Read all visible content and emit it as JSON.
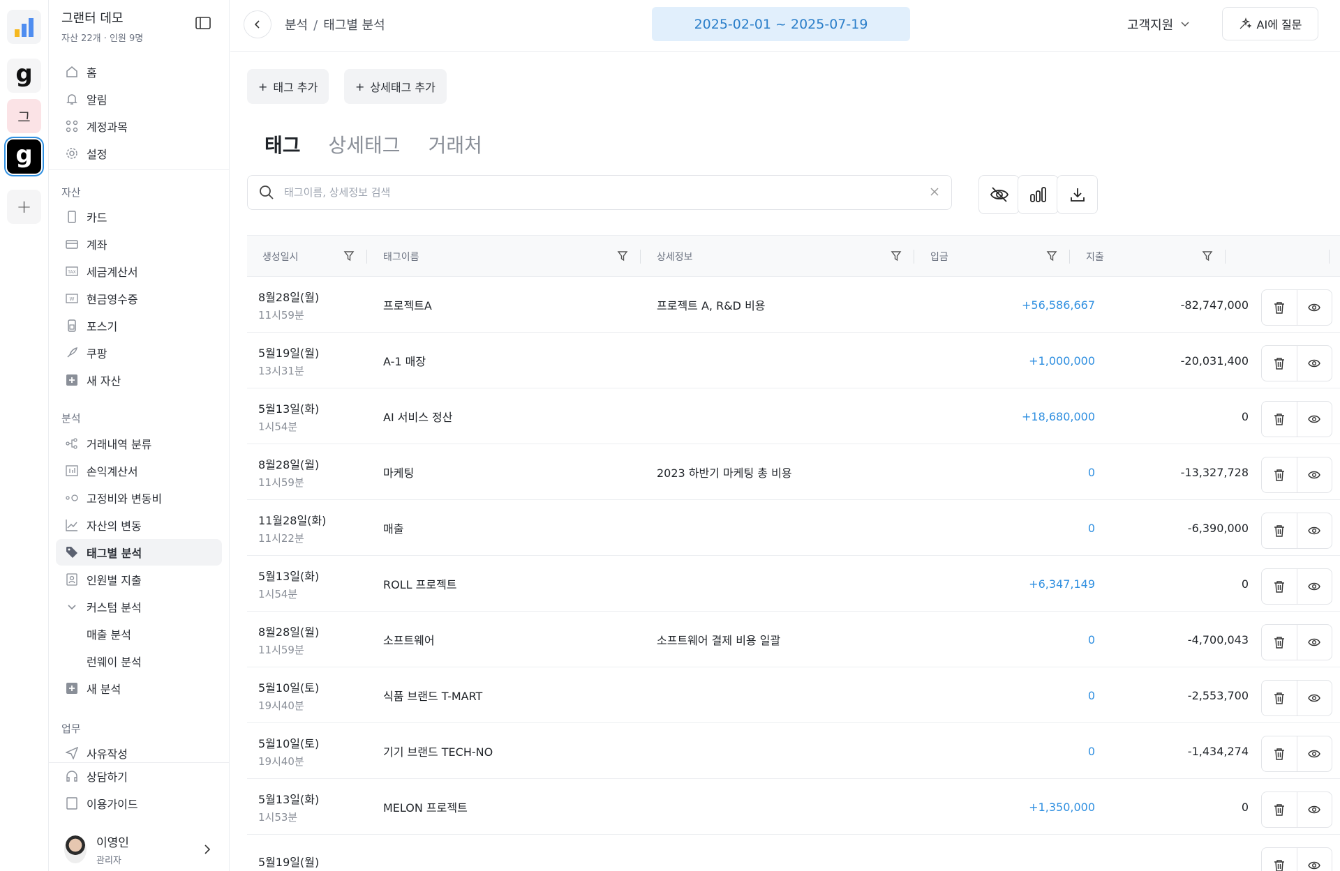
{
  "org": {
    "name": "그랜터 데모",
    "sub": "자산 22개 · 인원 9명"
  },
  "workspaces": {
    "k_label": "그"
  },
  "nav": {
    "home": "홈",
    "alerts": "알림",
    "accounts": "계정과목",
    "settings": "설정",
    "asset_title": "자산",
    "card": "카드",
    "bank": "계좌",
    "tax_invoice": "세금계산서",
    "cash_receipt": "현금영수증",
    "pos": "포스기",
    "coupang": "쿠팡",
    "new_asset": "새 자산",
    "analysis_title": "분석",
    "tx_classify": "거래내역 분류",
    "pl": "손익계산서",
    "fixed_var": "고정비와 변동비",
    "asset_change": "자산의 변동",
    "tag_analysis": "태그별 분석",
    "staff_spend": "인원별 지출",
    "custom": "커스텀 분석",
    "sales": "매출 분석",
    "runway": "런웨이 분석",
    "new_analysis": "새 분석",
    "work_title": "업무",
    "memo": "사유작성",
    "consult": "상담하기",
    "guide": "이용가이드"
  },
  "user": {
    "name": "이영인",
    "role": "관리자"
  },
  "header": {
    "crumb1": "분석",
    "crumb2": "태그별 분석",
    "date_range": "2025-02-01 ~ 2025-07-19",
    "support": "고객지원",
    "ai": "AI에 질문"
  },
  "toolbar": {
    "add_tag": "태그 추가",
    "add_subtag": "상세태그 추가"
  },
  "tabs": [
    "태그",
    "상세태그",
    "거래처"
  ],
  "search": {
    "placeholder": "태그이름, 상세정보 검색"
  },
  "columns": {
    "created": "생성일시",
    "name": "태그이름",
    "detail": "상세정보",
    "income": "입금",
    "expense": "지출"
  },
  "rows": [
    {
      "date": "8월28일(월)",
      "time": "11시59분",
      "name": "프로젝트A",
      "detail": "프로젝트 A, R&D 비용",
      "income": "+56,586,667",
      "expense": "-82,747,000"
    },
    {
      "date": "5월19일(월)",
      "time": "13시31분",
      "name": "A-1 매장",
      "detail": "",
      "income": "+1,000,000",
      "expense": "-20,031,400"
    },
    {
      "date": "5월13일(화)",
      "time": "1시54분",
      "name": "AI 서비스 정산",
      "detail": "",
      "income": "+18,680,000",
      "expense": "0"
    },
    {
      "date": "8월28일(월)",
      "time": "11시59분",
      "name": "마케팅",
      "detail": "2023 하반기 마케팅 총 비용",
      "income": "0",
      "expense": "-13,327,728"
    },
    {
      "date": "11월28일(화)",
      "time": "11시22분",
      "name": "매출",
      "detail": "",
      "income": "0",
      "expense": "-6,390,000"
    },
    {
      "date": "5월13일(화)",
      "time": "1시54분",
      "name": "ROLL 프로젝트",
      "detail": "",
      "income": "+6,347,149",
      "expense": "0"
    },
    {
      "date": "8월28일(월)",
      "time": "11시59분",
      "name": "소프트웨어",
      "detail": "소프트웨어 결제 비용 일괄",
      "income": "0",
      "expense": "-4,700,043"
    },
    {
      "date": "5월10일(토)",
      "time": "19시40분",
      "name": "식품 브랜드 T-MART",
      "detail": "",
      "income": "0",
      "expense": "-2,553,700"
    },
    {
      "date": "5월10일(토)",
      "time": "19시40분",
      "name": "기기 브랜드 TECH-NO",
      "detail": "",
      "income": "0",
      "expense": "-1,434,274"
    },
    {
      "date": "5월13일(화)",
      "time": "1시53분",
      "name": "MELON 프로젝트",
      "detail": "",
      "income": "+1,350,000",
      "expense": "0"
    },
    {
      "date": "5월19일(월)",
      "time": "",
      "name": "",
      "detail": "",
      "income": "",
      "expense": ""
    }
  ],
  "colors": {
    "accent": "#2f8fe0",
    "date_bg": "#e1effc",
    "selected_ws": "#2f8fe0"
  }
}
